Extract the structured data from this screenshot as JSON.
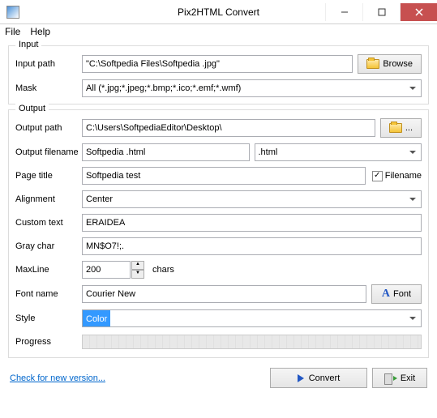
{
  "window": {
    "title": "Pix2HTML Convert"
  },
  "menu": {
    "file": "File",
    "help": "Help"
  },
  "input_group": {
    "title": "Input",
    "input_path_label": "Input path",
    "input_path_value": "\"C:\\Softpedia Files\\Softpedia .jpg\"",
    "browse_label": "Browse",
    "mask_label": "Mask",
    "mask_value": "All (*.jpg;*.jpeg;*.bmp;*.ico;*.emf;*.wmf)"
  },
  "output_group": {
    "title": "Output",
    "output_path_label": "Output path",
    "output_path_value": "C:\\Users\\SoftpediaEditor\\Desktop\\",
    "browse_small_label": "...",
    "filename_label": "Output filename",
    "filename_value": "Softpedia .html",
    "ext_value": ".html",
    "page_title_label": "Page title",
    "page_title_value": "Softpedia test",
    "filename_checkbox_label": "Filename",
    "filename_checked": true,
    "alignment_label": "Alignment",
    "alignment_value": "Center",
    "custom_text_label": "Custom text",
    "custom_text_value": "ERAIDEA",
    "gray_char_label": "Gray char",
    "gray_char_value": "MN$O7!;.",
    "maxline_label": "MaxLine",
    "maxline_value": "200",
    "chars_label": "chars",
    "font_name_label": "Font name",
    "font_name_value": "Courier New",
    "font_button_label": "Font",
    "style_label": "Style",
    "style_value": "Color",
    "progress_label": "Progress"
  },
  "footer": {
    "check_link": "Check for new version...",
    "convert_label": "Convert",
    "exit_label": "Exit"
  }
}
